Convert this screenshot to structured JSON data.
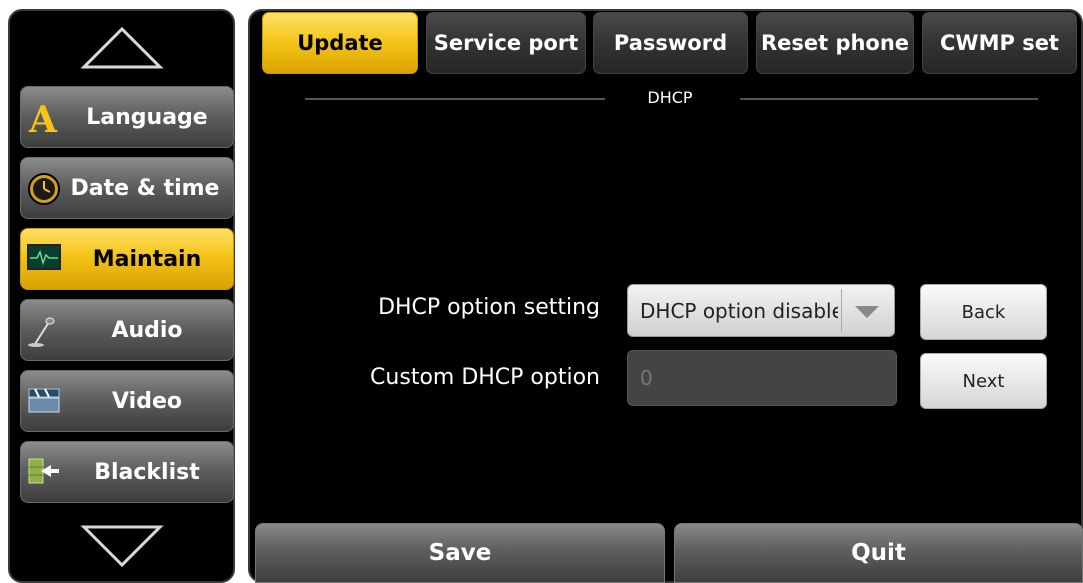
{
  "sidebar": {
    "items": [
      {
        "label": "Language",
        "icon": "letter-a-icon"
      },
      {
        "label": "Date & time",
        "icon": "clock-icon"
      },
      {
        "label": "Maintain",
        "icon": "monitor-icon",
        "active": true
      },
      {
        "label": "Audio",
        "icon": "microphone-icon"
      },
      {
        "label": "Video",
        "icon": "film-icon"
      },
      {
        "label": "Blacklist",
        "icon": "blocked-wall-icon"
      }
    ]
  },
  "tabs": [
    {
      "label": "Update",
      "active": true
    },
    {
      "label": "Service port"
    },
    {
      "label": "Password"
    },
    {
      "label": "Reset phone"
    },
    {
      "label": "CWMP set"
    }
  ],
  "section": {
    "title": "DHCP"
  },
  "form": {
    "dhcp_option_label": "DHCP option setting",
    "dhcp_option_value": "DHCP option disable",
    "custom_option_label": "Custom DHCP option",
    "custom_option_value": "0",
    "back_label": "Back",
    "next_label": "Next"
  },
  "footer": {
    "save_label": "Save",
    "quit_label": "Quit"
  },
  "colors": {
    "accent": "#f3c419",
    "panel": "#000000"
  }
}
